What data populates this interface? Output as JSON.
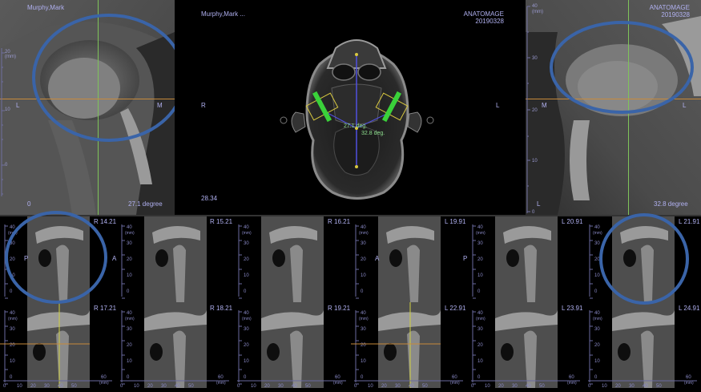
{
  "top_left": {
    "patient": "Murphy,Mark",
    "side_left": "L",
    "side_right": "M",
    "bottom_left": "0",
    "bottom_right": "27.1 degree",
    "scale_unit": "(mm)",
    "scale_ticks": [
      "20",
      "10",
      "0"
    ]
  },
  "top_center": {
    "patient": "Murphy,Mark ...",
    "brand": "ANATOMAGE",
    "date": "20190328",
    "side_left": "R",
    "side_right": "L",
    "angle_left": "27.1 deg.",
    "angle_right": "32.8 deg.",
    "bottom_left": "28.34"
  },
  "top_right": {
    "brand": "ANATOMAGE",
    "date": "20190328",
    "side_left": "M",
    "side_right": "L",
    "bottom_left": "L",
    "bottom_right": "32.8 degree",
    "scale_unit": "(mm)",
    "scale_ticks": [
      "40",
      "30",
      "20",
      "10",
      "0"
    ]
  },
  "slices_row1": [
    {
      "label": "R 14.21",
      "side_left": "P",
      "side_right": "A"
    },
    {
      "label": "R 15.21"
    },
    {
      "label": "R 16.21"
    },
    {
      "label": "L 19.91",
      "side_left": "A",
      "side_right": "P"
    },
    {
      "label": "L 20.91"
    },
    {
      "label": "L 21.91"
    }
  ],
  "slices_row2": [
    {
      "label": "R 17.21"
    },
    {
      "label": "R 18.21"
    },
    {
      "label": "R 19.21"
    },
    {
      "label": "L 22.91"
    },
    {
      "label": "L 23.91"
    },
    {
      "label": "L 24.91"
    }
  ],
  "slice_scale": {
    "unit": "(mm)",
    "y_ticks": [
      "40",
      "30",
      "20",
      "10",
      "0"
    ],
    "x_ticks": [
      "0",
      "10",
      "20",
      "30",
      "40",
      "50"
    ],
    "x_end": "60"
  },
  "colors": {
    "highlight_ellipse": "#3a64a8",
    "crosshair_vertical": "#7fc45a",
    "crosshair_horizontal": "#c88a3a",
    "guide_green": "#3ad13a",
    "guide_blue": "#5050e0",
    "guide_yellow": "#d8c840"
  }
}
